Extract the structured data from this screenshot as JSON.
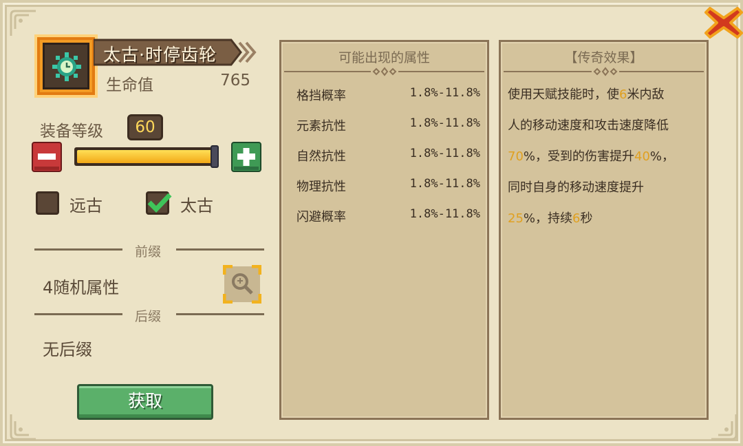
{
  "item": {
    "name": "太古·时停齿轮",
    "stat_label": "生命值",
    "stat_value": "765",
    "icon": "gear-clock-icon"
  },
  "level": {
    "label": "装备等级",
    "value": "60",
    "progress": 1.0
  },
  "rarity_options": [
    {
      "label": "远古",
      "checked": false
    },
    {
      "label": "太古",
      "checked": true
    }
  ],
  "prefix": {
    "section_label": "前缀",
    "value": "4随机属性"
  },
  "suffix": {
    "section_label": "后缀",
    "value": "无后缀"
  },
  "get_button": "获取",
  "attributes_panel": {
    "title": "可能出现的属性",
    "rows": [
      {
        "name": "格挡概率",
        "range": "1.8%-11.8%"
      },
      {
        "name": "元素抗性",
        "range": "1.8%-11.8%"
      },
      {
        "name": "自然抗性",
        "range": "1.8%-11.8%"
      },
      {
        "name": "物理抗性",
        "range": "1.8%-11.8%"
      },
      {
        "name": "闪避概率",
        "range": "1.8%-11.8%"
      }
    ]
  },
  "legend_panel": {
    "title": "【传奇效果】",
    "lines": [
      [
        {
          "t": "使用天赋技能时，使"
        },
        {
          "t": "6",
          "hl": true
        },
        {
          "t": "米内敌"
        }
      ],
      [
        {
          "t": "人的移动速度和攻击速度降低"
        }
      ],
      [
        {
          "t": "70",
          "hl": true
        },
        {
          "t": "%，受到的伤害提升"
        },
        {
          "t": "40",
          "hl": true
        },
        {
          "t": "%，"
        }
      ],
      [
        {
          "t": "同时自身的移动速度提升"
        }
      ],
      [
        {
          "t": "25",
          "hl": true
        },
        {
          "t": "%，持续"
        },
        {
          "t": "6",
          "hl": true
        },
        {
          "t": "秒"
        }
      ]
    ]
  },
  "colors": {
    "highlight": "#e0a020",
    "accent_orange": "#f29b24",
    "button_green": "#5bb06a",
    "close_red": "#d23a1e"
  }
}
